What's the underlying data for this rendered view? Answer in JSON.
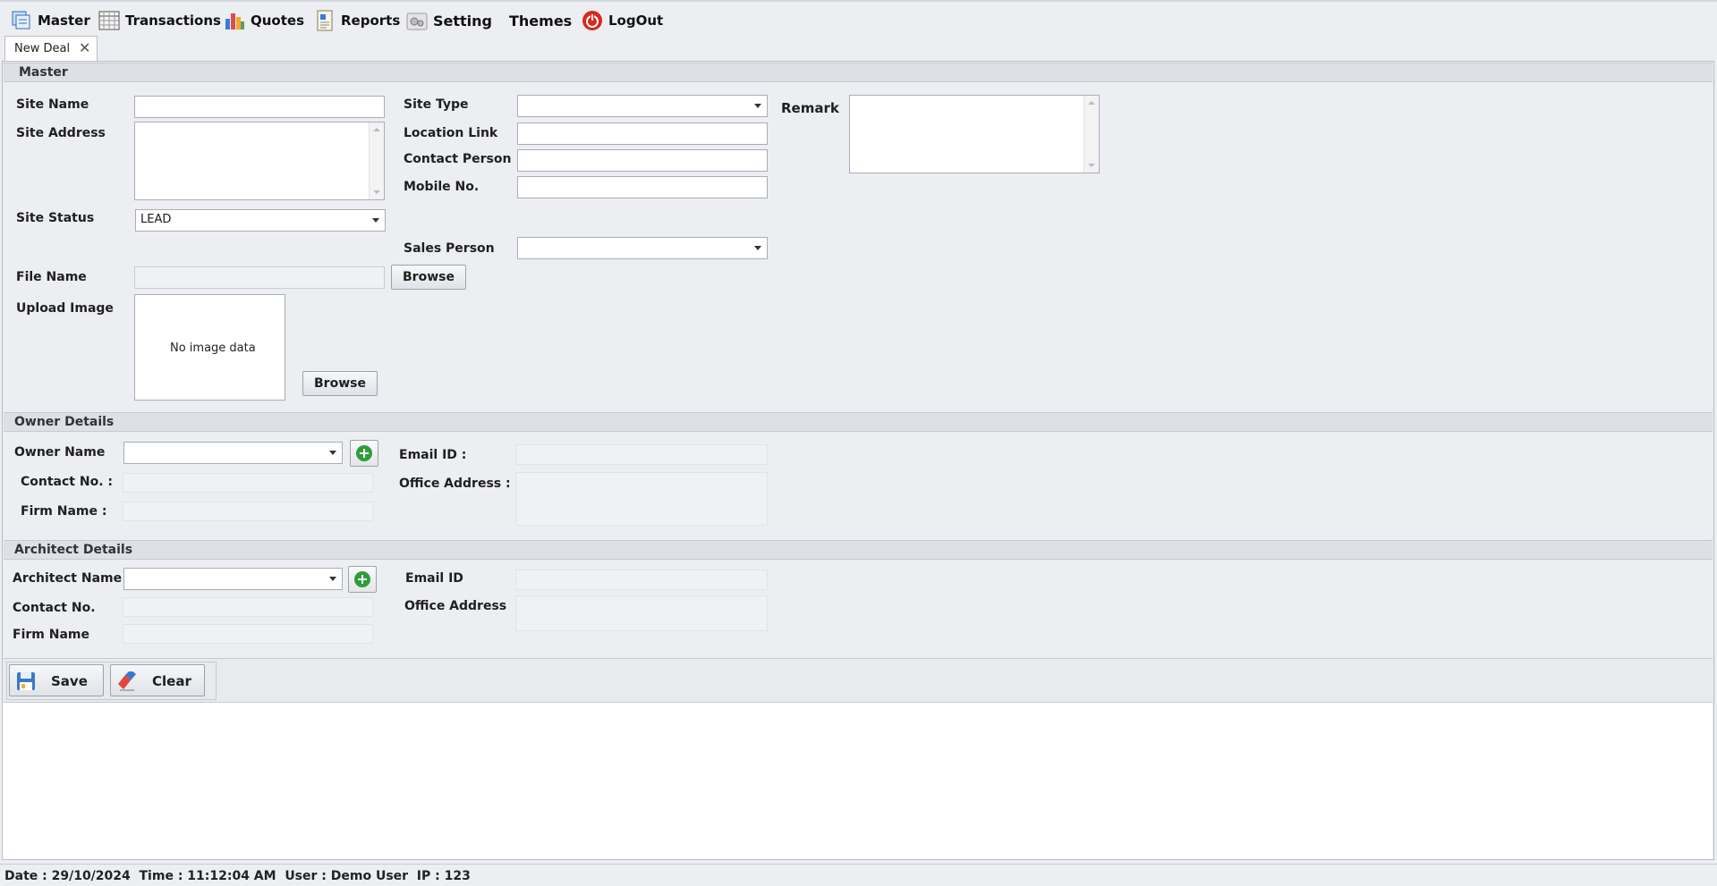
{
  "menu": {
    "master": "Master",
    "transactions": "Transactions",
    "quotes": "Quotes",
    "reports": "Reports",
    "setting": "Setting",
    "themes": "Themes",
    "logout": "LogOut"
  },
  "tab": {
    "label": "New Deal"
  },
  "master": {
    "section_title": "Master",
    "site_name_label": "Site Name",
    "site_address_label": "Site Address",
    "site_status_label": "Site Status",
    "site_status_value": "LEAD",
    "site_type_label": "Site Type",
    "location_link_label": "Location Link",
    "contact_person_label": "Contact Person",
    "mobile_label": "Mobile No.",
    "remark_label": "Remark",
    "sales_person_label": "Sales Person",
    "file_name_label": "File Name",
    "browse_label": "Browse",
    "upload_image_label": "Upload Image",
    "no_image_text": "No image data",
    "browse2_label": "Browse"
  },
  "owner": {
    "section_title": "Owner Details",
    "name_label": "Owner Name",
    "contact_label": "Contact No. :",
    "firm_label": "Firm Name :",
    "email_label": "Email ID :",
    "office_label": "Office Address :"
  },
  "architect": {
    "section_title": "Architect Details",
    "name_label": "Architect Name",
    "contact_label": "Contact No.",
    "firm_label": "Firm Name",
    "email_label": "Email ID",
    "office_label": "Office Address"
  },
  "actions": {
    "save_label": "Save",
    "clear_label": "Clear"
  },
  "status": {
    "text": "Date : 29/10/2024  Time : 11:12:04 AM  User : Demo User  IP : 123"
  },
  "colors": {
    "section_bg": "#dde0e6",
    "plus_green": "#2e9e3b",
    "logout_red": "#d9281c"
  }
}
